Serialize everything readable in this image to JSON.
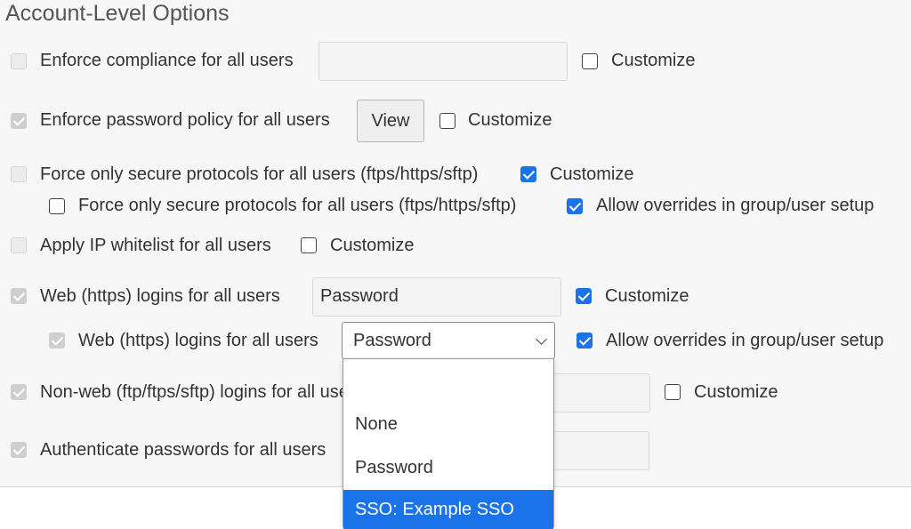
{
  "section": {
    "title": "Account-Level Options"
  },
  "rows": {
    "compliance": {
      "label": "Enforce compliance for all users",
      "field_value": "",
      "customize_label": "Customize",
      "customize_checked": false
    },
    "password_policy": {
      "label": "Enforce password policy for all users",
      "button_label": "View",
      "customize_label": "Customize",
      "customize_checked": false
    },
    "secure_protocols": {
      "label": "Force only secure protocols for all users (ftps/https/sftp)",
      "customize_label": "Customize",
      "customize_checked": true,
      "sub": {
        "label": "Force only secure protocols for all users (ftps/https/sftp)",
        "override_label": "Allow overrides in group/user setup",
        "override_checked": true
      }
    },
    "ip_whitelist": {
      "label": "Apply IP whitelist for all users",
      "customize_label": "Customize",
      "customize_checked": false
    },
    "web_logins": {
      "label": "Web (https) logins for all users",
      "field_value": "Password",
      "customize_label": "Customize",
      "customize_checked": true,
      "sub": {
        "label": "Web (https) logins for all users",
        "select_value": "Password",
        "override_label": "Allow overrides in group/user setup",
        "override_checked": true
      }
    },
    "nonweb_logins": {
      "label": "Non-web (ftp/ftps/sftp) logins for all users",
      "customize_label": "Customize",
      "customize_checked": false
    },
    "authenticate": {
      "label": "Authenticate passwords for all users"
    }
  },
  "dropdown": {
    "options": [
      "",
      "None",
      "Password",
      "SSO: Example SSO"
    ],
    "selected": "SSO: Example SSO"
  },
  "colors": {
    "accent": "#1a73e8",
    "panel_bg": "#f7f7f7"
  }
}
